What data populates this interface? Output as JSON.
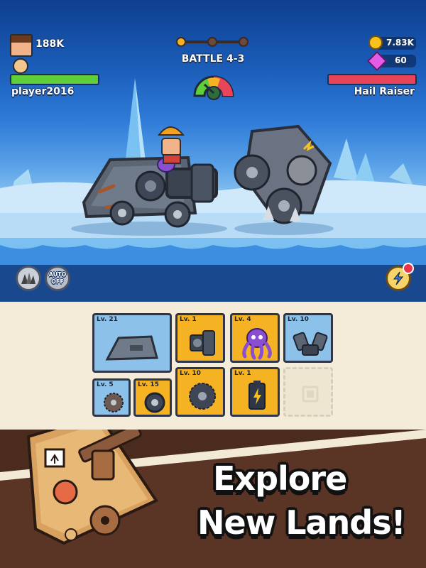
{
  "player": {
    "name": "player2016",
    "power": "188K",
    "hp_fraction": 1.0
  },
  "battle": {
    "title": "BATTLE 4-3",
    "stage_progress": "1 of 3"
  },
  "enemy": {
    "name": "Hail Raiser",
    "hp_fraction": 1.0
  },
  "currency": {
    "gold": "7.83K",
    "gems": "60"
  },
  "controls": {
    "auto_line1": "AUTO",
    "auto_line2": "OFF"
  },
  "inventory": {
    "large": {
      "level": "Lv. 21",
      "icon": "tank-body-icon"
    },
    "top_row": [
      {
        "level": "Lv. 1",
        "icon": "minigun-icon",
        "color": "yellow"
      },
      {
        "level": "Lv. 4",
        "icon": "octopus-icon",
        "color": "yellow"
      },
      {
        "level": "Lv. 10",
        "icon": "engine-icon",
        "color": "blue"
      }
    ],
    "bottom_row": [
      {
        "level": "Lv. 5",
        "icon": "sawblade-icon",
        "color": "blue"
      },
      {
        "level": "Lv. 15",
        "icon": "wheel-icon",
        "color": "yellow"
      },
      {
        "level": "Lv. 10",
        "icon": "spiked-wheel-icon",
        "color": "yellow"
      },
      {
        "level": "Lv. 1",
        "icon": "battery-icon",
        "color": "yellow"
      }
    ]
  },
  "promo": {
    "line1": "Explore",
    "line2": "New Lands!"
  },
  "colors": {
    "player_hp": "#5fce3a",
    "enemy_hp": "#e8445a",
    "slot_blue": "#8cc2ea",
    "slot_yellow": "#f5b324",
    "bottom_bg": "#4a2b1e"
  }
}
